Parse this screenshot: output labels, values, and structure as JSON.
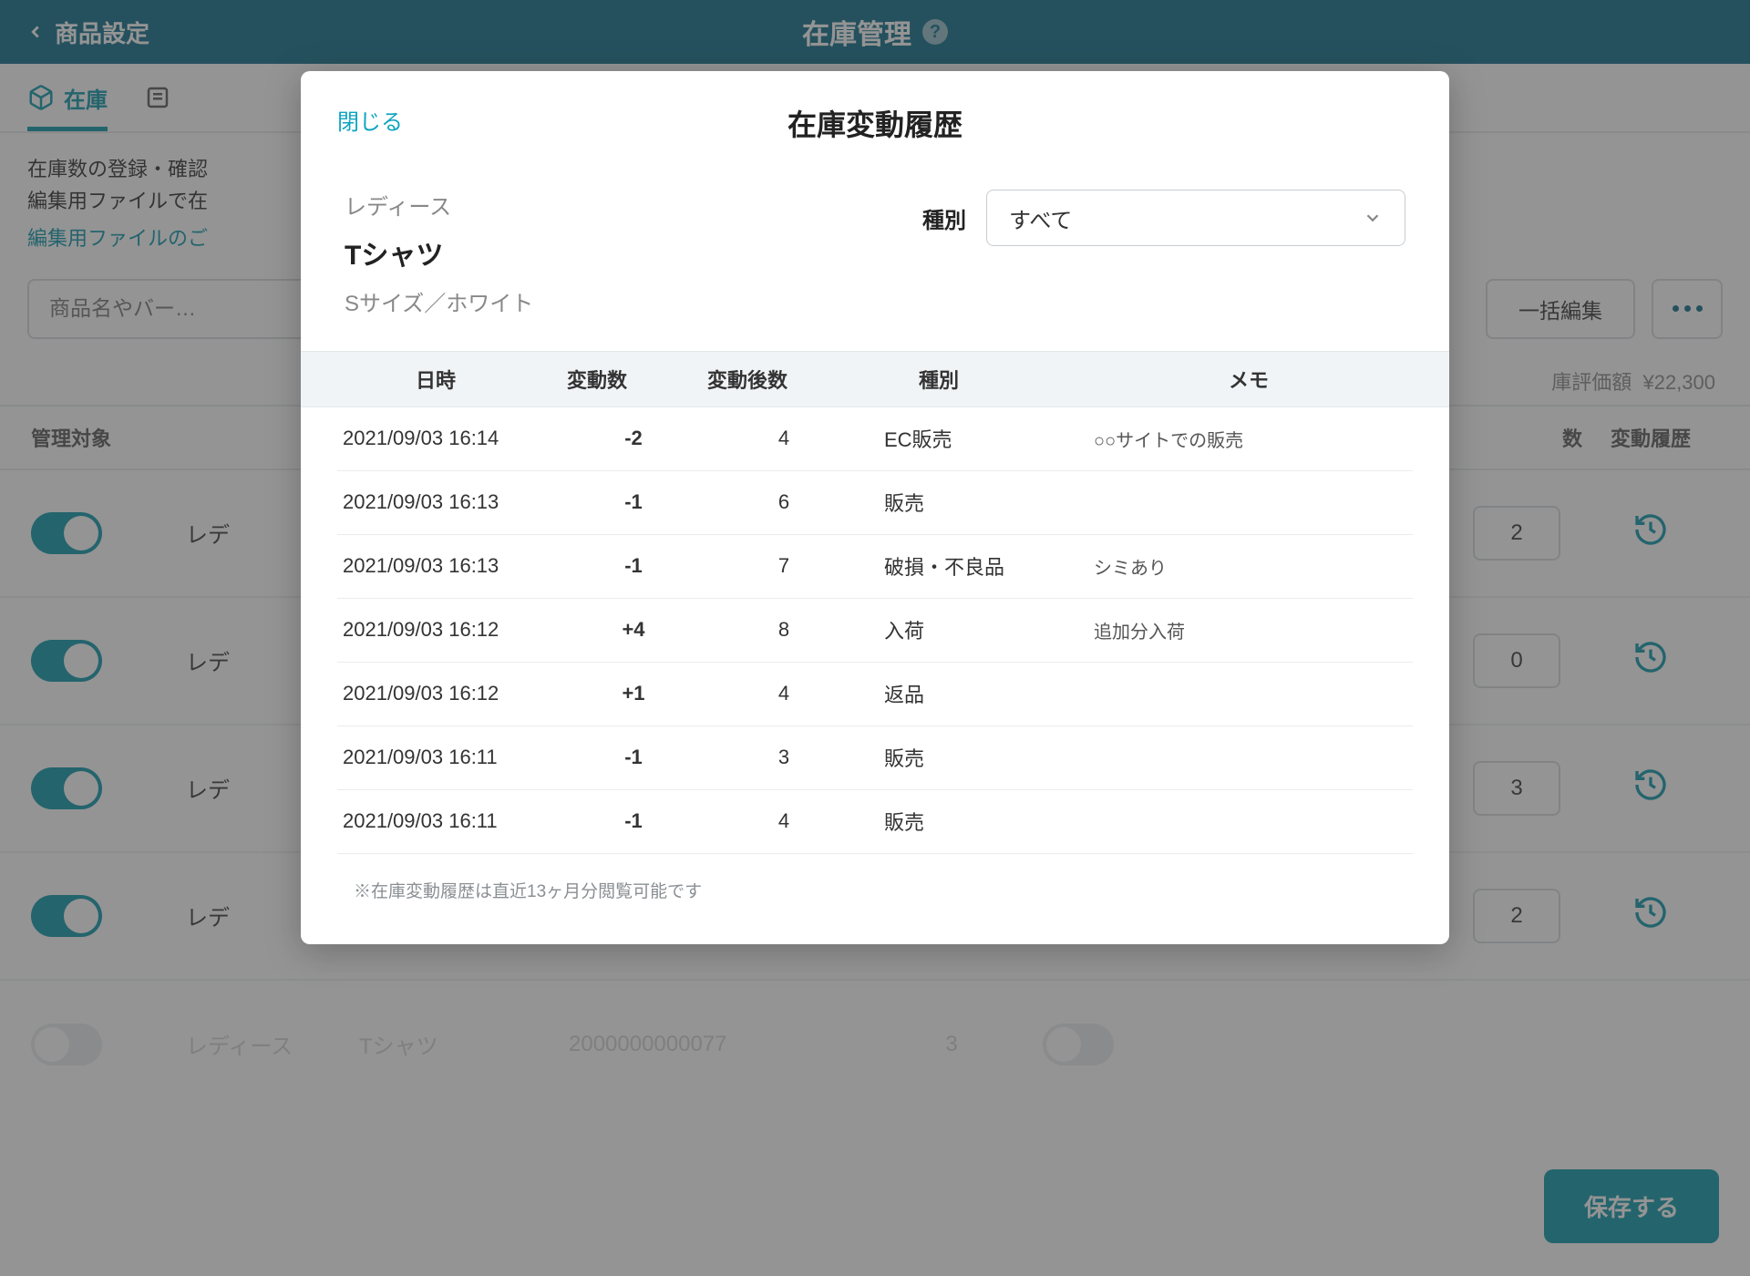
{
  "header": {
    "back_label": "商品設定",
    "title": "在庫管理"
  },
  "tabs": {
    "stock": "在庫"
  },
  "description": {
    "line1": "在庫数の登録・確認",
    "line2": "編集用ファイルで在",
    "link": "編集用ファイルのご"
  },
  "toolbar": {
    "search_placeholder": "商品名やバー…",
    "bulk_edit": "一括編集"
  },
  "valuation": {
    "label": "庫評価額",
    "value": "¥22,300"
  },
  "table_head": {
    "manage": "管理対象",
    "count": "数",
    "history": "変動履歴"
  },
  "rows": [
    {
      "cat_prefix": "レデ",
      "count": "2"
    },
    {
      "cat_prefix": "レデ",
      "count": "0"
    },
    {
      "cat_prefix": "レデ",
      "count": "3"
    },
    {
      "cat_prefix": "レデ",
      "count": "2"
    }
  ],
  "fade_row": {
    "cat": "レディース",
    "name": "Tシャツ",
    "barcode": "2000000000077",
    "qty": "3"
  },
  "save": "保存する",
  "modal": {
    "close": "閉じる",
    "title": "在庫変動履歴",
    "category": "レディース",
    "product": "Tシャツ",
    "variant": "Sサイズ／ホワイト",
    "type_label": "種別",
    "type_value": "すべて",
    "columns": {
      "date": "日時",
      "change": "変動数",
      "after": "変動後数",
      "type": "種別",
      "memo": "メモ"
    },
    "rows": [
      {
        "date": "2021/09/03 16:14",
        "change": "-2",
        "after": "4",
        "type": "EC販売",
        "memo": "○○サイトでの販売"
      },
      {
        "date": "2021/09/03 16:13",
        "change": "-1",
        "after": "6",
        "type": "販売",
        "memo": ""
      },
      {
        "date": "2021/09/03 16:13",
        "change": "-1",
        "after": "7",
        "type": "破損・不良品",
        "memo": "シミあり"
      },
      {
        "date": "2021/09/03 16:12",
        "change": "+4",
        "after": "8",
        "type": "入荷",
        "memo": "追加分入荷"
      },
      {
        "date": "2021/09/03 16:12",
        "change": "+1",
        "after": "4",
        "type": "返品",
        "memo": ""
      },
      {
        "date": "2021/09/03 16:11",
        "change": "-1",
        "after": "3",
        "type": "販売",
        "memo": ""
      },
      {
        "date": "2021/09/03 16:11",
        "change": "-1",
        "after": "4",
        "type": "販売",
        "memo": ""
      }
    ],
    "footnote": "※在庫変動履歴は直近13ヶ月分閲覧可能です"
  }
}
